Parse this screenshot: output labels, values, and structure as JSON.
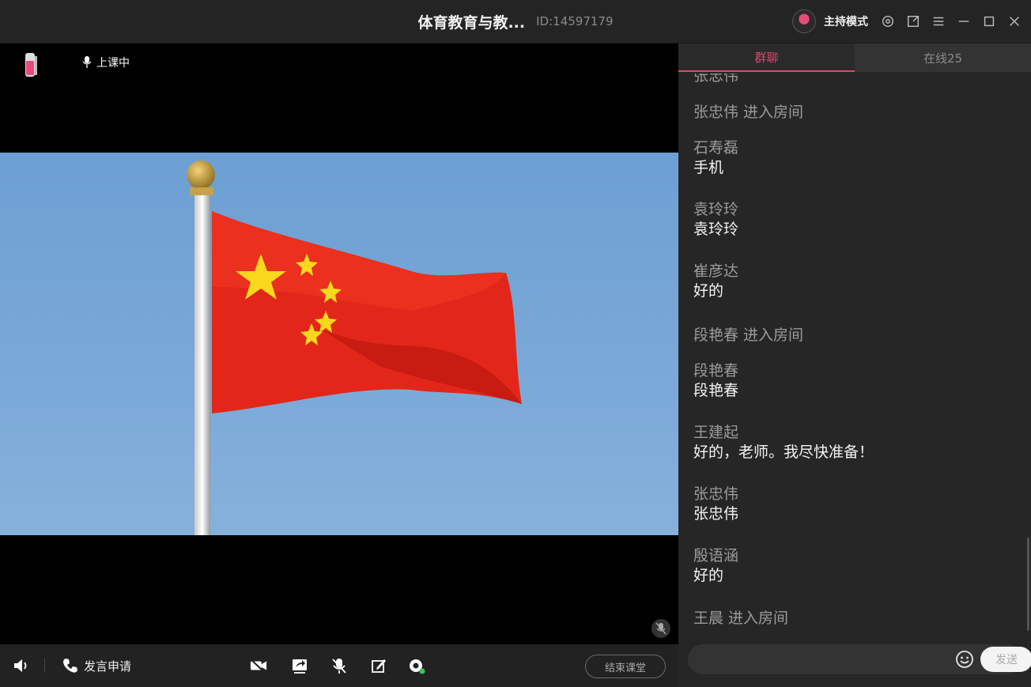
{
  "titlebar": {
    "title": "体育教育与教...",
    "room_id": "ID:14597179",
    "host_mode": "主持模式"
  },
  "video": {
    "status": "上课中"
  },
  "toolbar": {
    "apply_label": "发言申请",
    "end_label": "结束课堂"
  },
  "panel": {
    "tabs": [
      {
        "label": "群聊"
      },
      {
        "label": "在线25"
      }
    ],
    "messages": [
      {
        "sys": "张忠伟"
      },
      {
        "sys": "张忠伟 进入房间"
      },
      {
        "name": "石寿磊",
        "text": "手机"
      },
      {
        "name": "袁玲玲",
        "text": "袁玲玲"
      },
      {
        "name": "崔彦达",
        "text": "好的"
      },
      {
        "sys": "段艳春 进入房间"
      },
      {
        "name": "段艳春",
        "text": "段艳春"
      },
      {
        "name": "王建起",
        "text": "好的，老师。我尽快准备！"
      },
      {
        "name": "张忠伟",
        "text": "张忠伟"
      },
      {
        "name": "殷语涵",
        "text": "好的"
      },
      {
        "sys": "王晨 进入房间"
      }
    ],
    "send_label": "发送"
  },
  "colors": {
    "accent": "#e0456b",
    "background": "#1b1b1b",
    "panel": "#262626"
  }
}
